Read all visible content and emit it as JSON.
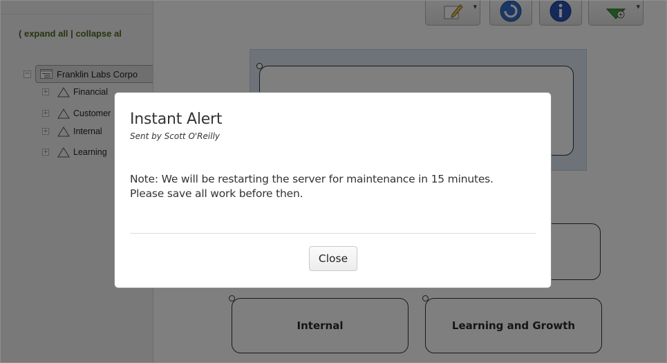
{
  "sidebar": {
    "paren_open": "(",
    "expand_all": "expand all",
    "separator": "|",
    "collapse_all": "collapse al",
    "tree": {
      "root": {
        "toggle": "−",
        "label": "Franklin Labs Corpo",
        "icon": "org-chart-icon"
      },
      "children": [
        {
          "toggle": "+",
          "label": "Financial",
          "icon": "triangle-icon"
        },
        {
          "toggle": "+",
          "label": "Customer",
          "icon": "triangle-icon"
        },
        {
          "toggle": "+",
          "label": "Internal",
          "icon": "triangle-icon"
        },
        {
          "toggle": "+",
          "label": "Learning",
          "icon": "triangle-icon"
        }
      ]
    }
  },
  "toolbar": {
    "buttons": [
      {
        "name": "edit-dropdown",
        "icon": "edit-icon"
      },
      {
        "name": "refresh",
        "icon": "refresh-icon"
      },
      {
        "name": "info",
        "icon": "info-icon"
      },
      {
        "name": "add-dropdown",
        "icon": "add-icon"
      }
    ]
  },
  "strategy_map": {
    "nodes": [
      {
        "label": ""
      },
      {
        "label": ""
      },
      {
        "label": "Internal"
      },
      {
        "label": "Learning and Growth"
      }
    ]
  },
  "modal": {
    "title": "Instant Alert",
    "subtitle": "Sent by Scott O'Reilly",
    "message_line1": "Note: We will be restarting the server for maintenance in 15 minutes.",
    "message_line2": "Please save all work before then.",
    "close_label": "Close"
  },
  "colors": {
    "link_green": "#4f6b1c",
    "panel_blue": "#dbe6f2",
    "overlay": "rgba(0,0,0,0.5)"
  }
}
